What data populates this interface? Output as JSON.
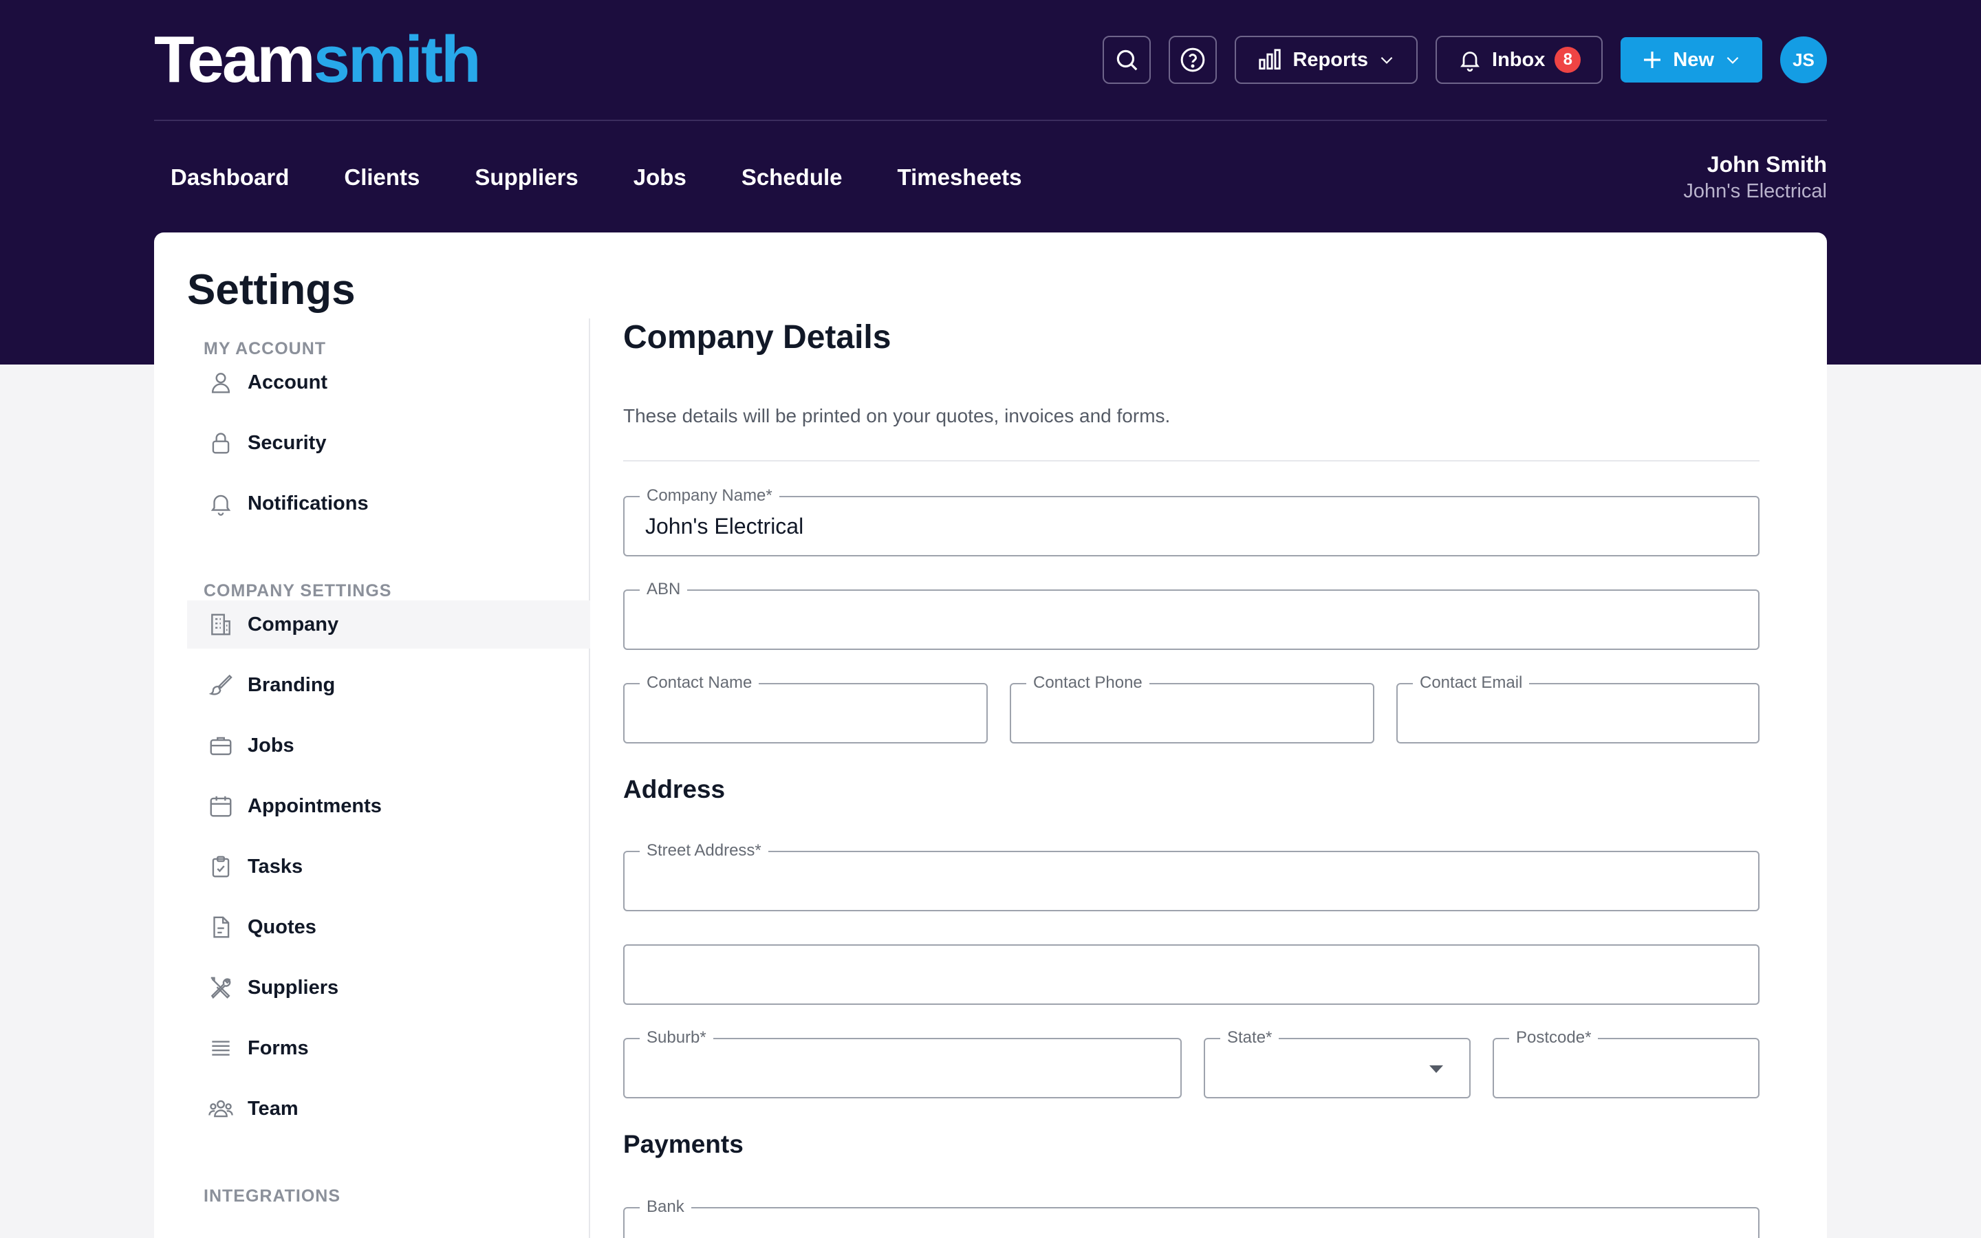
{
  "logo": {
    "part1": "Team",
    "part2": "smith"
  },
  "header": {
    "reports_label": "Reports",
    "inbox_label": "Inbox",
    "inbox_count": "8",
    "new_label": "New",
    "avatar_initials": "JS"
  },
  "nav": {
    "items": [
      "Dashboard",
      "Clients",
      "Suppliers",
      "Jobs",
      "Schedule",
      "Timesheets"
    ]
  },
  "user": {
    "name": "John Smith",
    "company": "John's Electrical"
  },
  "page": {
    "title": "Settings"
  },
  "sidebar": {
    "my_account_label": "MY ACCOUNT",
    "company_settings_label": "COMPANY SETTINGS",
    "integrations_label": "INTEGRATIONS",
    "account_items": [
      {
        "label": "Account",
        "icon": "user-icon"
      },
      {
        "label": "Security",
        "icon": "lock-icon"
      },
      {
        "label": "Notifications",
        "icon": "bell-icon"
      }
    ],
    "company_items": [
      {
        "label": "Company",
        "icon": "building-icon",
        "active": true
      },
      {
        "label": "Branding",
        "icon": "brush-icon"
      },
      {
        "label": "Jobs",
        "icon": "briefcase-icon"
      },
      {
        "label": "Appointments",
        "icon": "calendar-icon"
      },
      {
        "label": "Tasks",
        "icon": "clipboard-check-icon"
      },
      {
        "label": "Quotes",
        "icon": "document-icon"
      },
      {
        "label": "Suppliers",
        "icon": "tools-icon"
      },
      {
        "label": "Forms",
        "icon": "list-icon"
      },
      {
        "label": "Team",
        "icon": "team-icon"
      }
    ]
  },
  "form": {
    "title": "Company Details",
    "subtitle": "These details will be printed on your quotes, invoices and forms.",
    "company_name_label": "Company Name*",
    "company_name_value": "John's Electrical",
    "abn_label": "ABN",
    "abn_value": "",
    "contact_name_label": "Contact Name",
    "contact_phone_label": "Contact Phone",
    "contact_email_label": "Contact Email",
    "address_heading": "Address",
    "street_label": "Street Address*",
    "suburb_label": "Suburb*",
    "state_label": "State*",
    "state_value": "",
    "postcode_label": "Postcode*",
    "payments_heading": "Payments",
    "bank_label": "Bank"
  },
  "colors": {
    "header_bg": "#1c0d3e",
    "brand_blue": "#149de4",
    "logo_accent": "#28a8ea",
    "badge_red": "#ef4444"
  }
}
